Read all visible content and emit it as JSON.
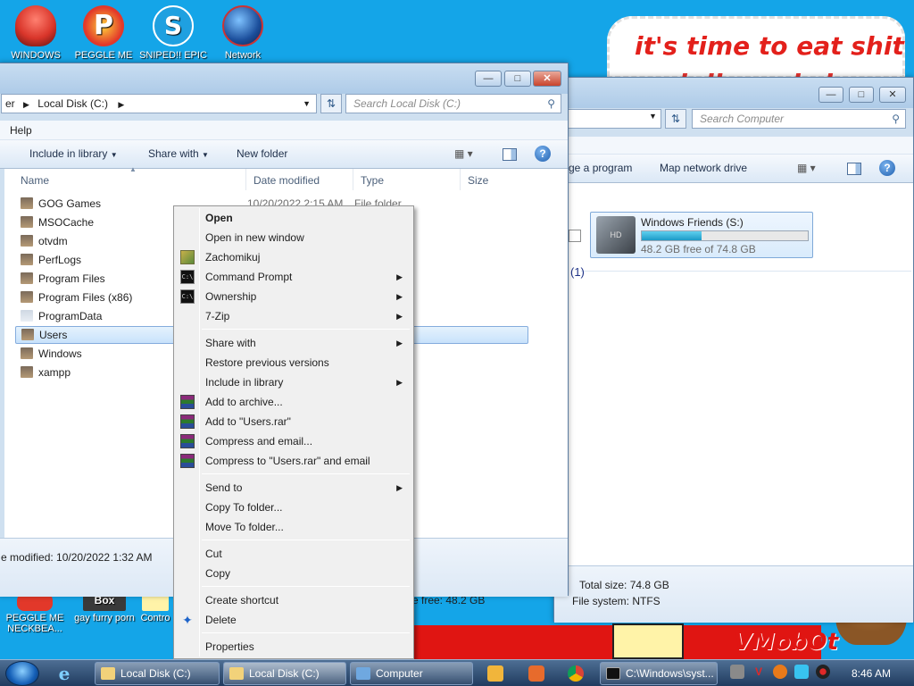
{
  "desktop": {
    "icons": [
      {
        "label": "WINDOWS",
        "color": "#d9352a"
      },
      {
        "label": "PEGGLE ME",
        "color": "#e2382a"
      },
      {
        "label": "SNIPED!! EPIC",
        "color": "#1fa0e0"
      },
      {
        "label": "Network",
        "color": "#1c4f9c"
      }
    ],
    "sign_text": "it's time to eat shit",
    "sign_text_2": "and die and share",
    "bottom_icons": [
      {
        "label": "PEGGLE ME NECKBEA..."
      },
      {
        "label": "gay furry porn"
      },
      {
        "label": "Contro"
      }
    ],
    "box_label": "Box",
    "watermark": "VMobOt"
  },
  "window_back": {
    "search_placeholder": "Search Computer",
    "toolbar": {
      "uninstall_label": "ge a program",
      "map_drive_label": "Map network drive"
    },
    "drive": {
      "name": "Windows Friends (S:)",
      "free_text": "48.2 GB free of 74.8 GB",
      "used_fraction": 0.36
    },
    "count_label": "(1)",
    "details": {
      "total_size": "Total size: 74.8 GB",
      "file_system": "File system: NTFS",
      "space_free": "e free: 48.2 GB"
    }
  },
  "window_front": {
    "breadcrumb_prev": "er",
    "breadcrumb_current": "Local Disk (C:)",
    "search_placeholder": "Search Local Disk (C:)",
    "menu": {
      "help": "Help"
    },
    "toolbar": {
      "include_label": "Include in library",
      "share_label": "Share with",
      "new_folder_label": "New folder"
    },
    "columns": {
      "name": "Name",
      "date": "Date modified",
      "type": "Type",
      "size": "Size"
    },
    "first_row": {
      "date": "10/20/2022 2:15 AM",
      "type": "File folder"
    },
    "folders": [
      {
        "name": "GOG Games"
      },
      {
        "name": "MSOCache"
      },
      {
        "name": "otvdm"
      },
      {
        "name": "PerfLogs"
      },
      {
        "name": "Program Files"
      },
      {
        "name": "Program Files (x86)"
      },
      {
        "name": "ProgramData"
      },
      {
        "name": "Users"
      },
      {
        "name": "Windows"
      },
      {
        "name": "xampp"
      }
    ],
    "details_text": "e modified: 10/20/2022 1:32 AM"
  },
  "context_menu": {
    "items": [
      {
        "label": "Open"
      },
      {
        "label": "Open in new window"
      },
      {
        "label": "Zachomikuj"
      },
      {
        "label": "Command Prompt"
      },
      {
        "label": "Ownership"
      },
      {
        "label": "7-Zip"
      },
      {
        "label": "Share with"
      },
      {
        "label": "Restore previous versions"
      },
      {
        "label": "Include in library"
      },
      {
        "label": "Add to archive..."
      },
      {
        "label": "Add to \"Users.rar\""
      },
      {
        "label": "Compress and email..."
      },
      {
        "label": "Compress to \"Users.rar\" and email"
      },
      {
        "label": "Send to"
      },
      {
        "label": "Copy To folder..."
      },
      {
        "label": "Move To folder..."
      },
      {
        "label": "Cut"
      },
      {
        "label": "Copy"
      },
      {
        "label": "Create shortcut"
      },
      {
        "label": "Delete"
      },
      {
        "label": "Properties"
      }
    ]
  },
  "taskbar": {
    "buttons": [
      {
        "label": "Local Disk (C:)"
      },
      {
        "label": "Local Disk (C:)"
      },
      {
        "label": "Computer"
      },
      {
        "label": "C:\\Windows\\syst..."
      }
    ],
    "clock": "8:46 AM"
  }
}
